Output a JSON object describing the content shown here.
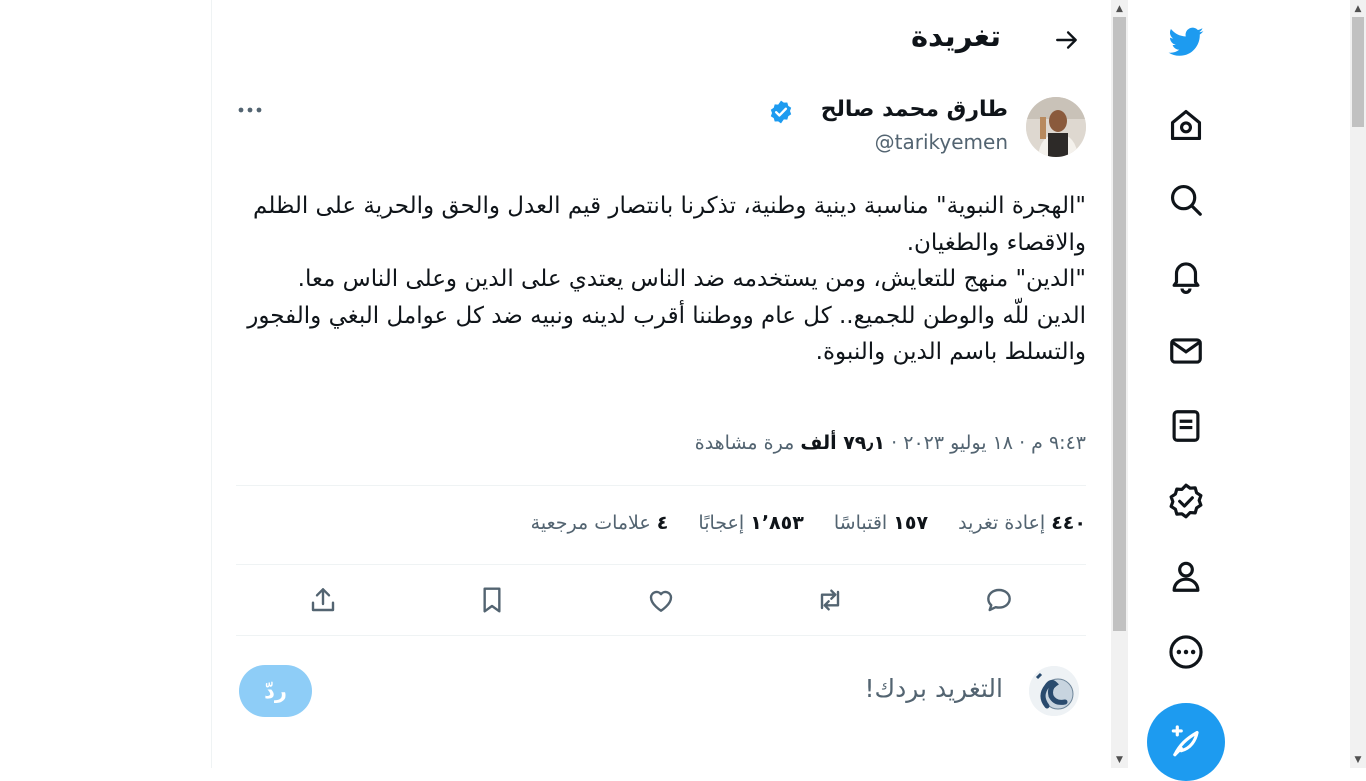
{
  "header": {
    "title": "تغريدة",
    "back_icon": "arrow-right-icon"
  },
  "tweet": {
    "author_name": "طارق محمد صالح",
    "handle": "@tarikyemen",
    "verified": true,
    "text_lines": [
      "\"الهجرة النبوية\" مناسبة دينية وطنية، تذكرنا بانتصار قيم العدل والحق والحرية على الظلم والاقصاء والطغيان.",
      "\"الدين\" منهج للتعايش، ومن يستخدمه ضد الناس يعتدي على الدين وعلى الناس معا.",
      "الدين للّه والوطن للجميع.. كل عام ووطننا أقرب لدينه ونبيه ضد كل عوامل البغي والفجور والتسلط باسم الدين والنبوة."
    ],
    "time": "٩:٤٣ م",
    "date": "١٨ يوليو ٢٠٢٣",
    "separator": "·",
    "views_count": "٧٩٫١ ألف",
    "views_label": "مرة مشاهدة"
  },
  "stats": [
    {
      "count": "٤٤٠",
      "label": "إعادة تغريد"
    },
    {
      "count": "١٥٧",
      "label": "اقتباسًا"
    },
    {
      "count": "١٬٨٥٣",
      "label": "إعجابًا"
    },
    {
      "count": "٤",
      "label": "علامات مرجعية"
    }
  ],
  "reply": {
    "placeholder": "التغريد بردك!",
    "button_label": "ردّ"
  },
  "nav_icons": [
    "twitter-logo-icon",
    "home-icon",
    "search-icon",
    "notifications-bell-icon",
    "messages-envelope-icon",
    "lists-icon",
    "verified-icon",
    "profile-icon",
    "more-circle-icon",
    "compose-feather-icon"
  ],
  "colors": {
    "accent": "#1d9bf0",
    "reply_button_disabled": "#8ecdf7",
    "secondary_text": "#536471"
  }
}
